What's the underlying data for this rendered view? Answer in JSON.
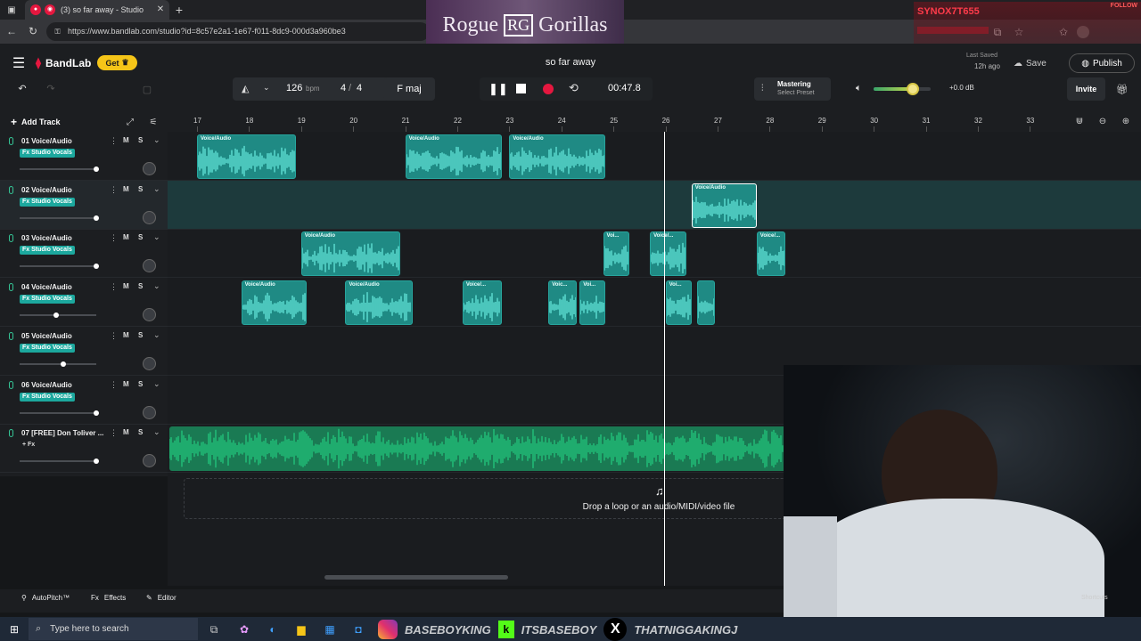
{
  "browser": {
    "tab_title": "(3) so far away - Studio",
    "url": "https://www.bandlab.com/studio?id=8c57e2a1-1e67-f011-8dc9-000d3a960be3"
  },
  "overlay": {
    "logo_text_left": "Rogue",
    "logo_text_right": "Gorillas",
    "logo_monogram": "RG",
    "chat_user": "SYNOX7T655",
    "follow": "FOLLOW"
  },
  "app": {
    "brand": "BandLab",
    "get_label": "Get",
    "project_title": "so far away",
    "last_saved_label": "Last Saved",
    "last_saved_time": "12h ago",
    "save_label": "Save",
    "publish_label": "Publish",
    "invite_label": "Invite",
    "tempo": "126",
    "tempo_unit": "bpm",
    "time_sig_top": "4",
    "time_sig_bottom": "4",
    "key": "F maj",
    "time_display": "00:47.8",
    "mastering_title": "Mastering",
    "mastering_preset": "Select Preset",
    "volume_db": "+0.0 dB",
    "volume_level": 0.68,
    "add_track_label": "Add Track",
    "drop_hint": "Drop a loop or an audio/MIDI/video file"
  },
  "ruler": {
    "bars": [
      "17",
      "18",
      "19",
      "20",
      "21",
      "22",
      "23",
      "24",
      "25",
      "26",
      "27",
      "28",
      "29",
      "30",
      "31",
      "32",
      "33"
    ],
    "playhead_bar": 25.98
  },
  "tracks": [
    {
      "name": "01  Voice/Audio",
      "fx": "Fx Studio Vocals",
      "mute": "M",
      "solo": "S",
      "volume": 1.0,
      "clips": [
        {
          "label": "Voice/Audio",
          "start": 17.0,
          "end": 18.9
        },
        {
          "label": "Voice/Audio",
          "start": 21.0,
          "end": 22.85
        },
        {
          "label": "Voice/Audio",
          "start": 23.0,
          "end": 24.85
        }
      ]
    },
    {
      "name": "02  Voice/Audio",
      "fx": "Fx Studio Vocals",
      "mute": "M",
      "solo": "S",
      "volume": 1.0,
      "clips": [
        {
          "label": "Voice/Audio",
          "start": 26.5,
          "end": 27.75
        }
      ]
    },
    {
      "name": "03  Voice/Audio",
      "fx": "Fx Studio Vocals",
      "mute": "M",
      "solo": "S",
      "volume": 1.0,
      "clips": [
        {
          "label": "Voice/Audio",
          "start": 19.0,
          "end": 20.9
        },
        {
          "label": "Voi...",
          "start": 24.8,
          "end": 25.3
        },
        {
          "label": "Voice/...",
          "start": 25.7,
          "end": 26.4
        },
        {
          "label": "Voice/...",
          "start": 27.75,
          "end": 28.3
        }
      ]
    },
    {
      "name": "04  Voice/Audio",
      "fx": "Fx Studio Vocals",
      "mute": "M",
      "solo": "S",
      "volume": 0.48,
      "clips": [
        {
          "label": "Voice/Audio",
          "start": 17.85,
          "end": 19.1
        },
        {
          "label": "Voice/Audio",
          "start": 19.85,
          "end": 21.15
        },
        {
          "label": "Voice/...",
          "start": 22.1,
          "end": 22.85
        },
        {
          "label": "Voic...",
          "start": 23.75,
          "end": 24.3
        },
        {
          "label": "Voi...",
          "start": 24.35,
          "end": 24.85
        },
        {
          "label": "Voi...",
          "start": 26.0,
          "end": 26.5
        },
        {
          "label": "",
          "start": 26.6,
          "end": 26.95
        }
      ]
    },
    {
      "name": "05  Voice/Audio",
      "fx": "Fx Studio Vocals",
      "mute": "M",
      "solo": "S",
      "volume": 0.57,
      "clips": []
    },
    {
      "name": "06  Voice/Audio",
      "fx": "Fx Studio Vocals",
      "mute": "M",
      "solo": "S",
      "volume": 1.0,
      "clips": []
    },
    {
      "name": "07  [FREE] Don Toliver ...",
      "fx": "+ Fx",
      "mute": "M",
      "solo": "S",
      "volume": 1.0,
      "clips": []
    }
  ],
  "bottom": {
    "autopitch": "AutoPitch™",
    "effects": "Effects",
    "editor": "Editor",
    "shortcuts": "Shortcuts"
  },
  "taskbar": {
    "search_placeholder": "Type here to search",
    "socials": [
      "BASEBOYKING",
      "ITSBASEBOY",
      "THATNIGGAKINGJ"
    ]
  },
  "colors": {
    "accent": "#1ca89e",
    "record": "#e5173f",
    "get_badge": "#f5c518",
    "master_track": "#22c27a"
  }
}
